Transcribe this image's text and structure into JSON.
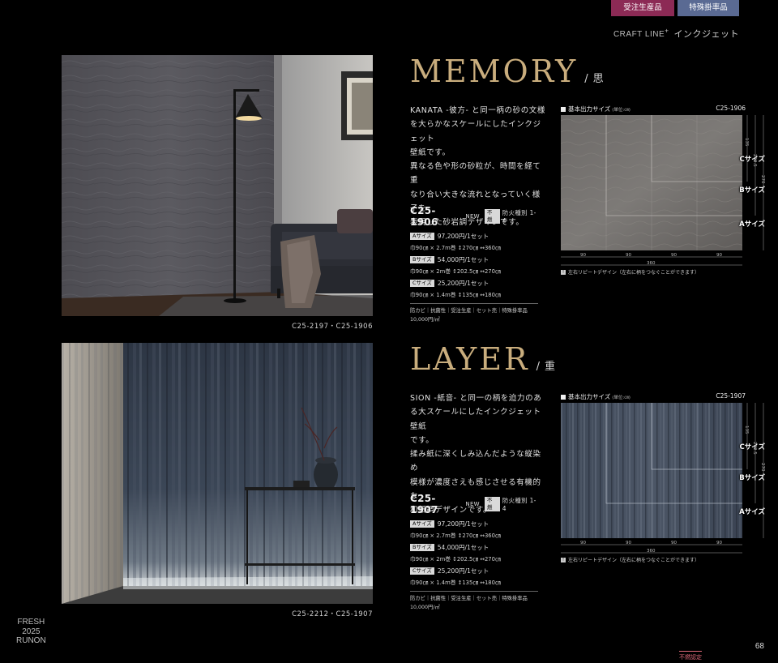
{
  "header": {
    "tag_made_to_order": "受注生産品",
    "tag_special_order": "特殊掛率品",
    "series_brand": "CRAFT LINE",
    "series_mark": "+",
    "series_type": "インクジェット"
  },
  "sections": [
    {
      "title_en": "MEMORY",
      "slash": "/",
      "title_jp": "思",
      "photo_credit": "C25-2197・C25-1906",
      "description": [
        "KANATA -彼方- と同一柄の砂の文様",
        "を大らかなスケールにしたインクジェット",
        "壁紙です。",
        "異なる色や形の砂粒が、時間を経て重",
        "なり合い大きな流れとなっていく様子を",
        "表現した砂岩調デザインです。"
      ],
      "product": {
        "code": "C25-1906",
        "new_label": "NEW",
        "fire_badge": "不燃",
        "fire_class": "防火種別 1-4",
        "sizes": [
          {
            "badge": "Aサイズ",
            "price": "97,200円/1セット",
            "dims": "巾90㎝ × 2.7m巻 ↕270㎝ ↔360㎝"
          },
          {
            "badge": "Bサイズ",
            "price": "54,000円/1セット",
            "dims": "巾90㎝ × 2m巻 ↕202.5㎝ ↔270㎝"
          },
          {
            "badge": "Cサイズ",
            "price": "25,200円/1セット",
            "dims": "巾90㎝ × 1.4m巻 ↕135㎝ ↔180㎝"
          }
        ],
        "features": "防カビ｜抗菌性｜受注生産｜セット売｜特殊掛率品",
        "unit_price": "10,000円/㎡"
      },
      "diagram": {
        "label": "基本出力サイズ",
        "unit": "(単位:㎝)",
        "code": "C25-1906",
        "size_c": "Cサイズ",
        "size_b": "Bサイズ",
        "size_a": "Aサイズ",
        "h135": "135",
        "h2025": "202.5",
        "h270": "270",
        "w90": "90",
        "w360": "360",
        "repeat_icon": "!",
        "repeat_note": "左右リピートデザイン（左右に柄をつなぐことができます）"
      }
    },
    {
      "title_en": "LAYER",
      "slash": "/",
      "title_jp": "重",
      "photo_credit": "C25-2212・C25-1907",
      "description": [
        "SION -紙音- と同一の柄を迫力のあ",
        "る大スケールにしたインクジェット壁紙",
        "です。",
        "揉み紙に深くしみ込んだような縦染め",
        "模様が濃度さえも感じさせる有機的な",
        "和紙調デザインです。"
      ],
      "product": {
        "code": "C25-1907",
        "new_label": "NEW",
        "fire_badge": "不燃",
        "fire_class": "防火種別 1-4",
        "sizes": [
          {
            "badge": "Aサイズ",
            "price": "97,200円/1セット",
            "dims": "巾90㎝ × 2.7m巻 ↕270㎝ ↔360㎝"
          },
          {
            "badge": "Bサイズ",
            "price": "54,000円/1セット",
            "dims": "巾90㎝ × 2m巻 ↕202.5㎝ ↔270㎝"
          },
          {
            "badge": "Cサイズ",
            "price": "25,200円/1セット",
            "dims": "巾90㎝ × 1.4m巻 ↕135㎝ ↔180㎝"
          }
        ],
        "features": "防カビ｜抗菌性｜受注生産｜セット売｜特殊掛率品",
        "unit_price": "10,000円/㎡"
      },
      "diagram": {
        "label": "基本出力サイズ",
        "unit": "(単位:㎝)",
        "code": "C25-1907",
        "size_c": "Cサイズ",
        "size_b": "Bサイズ",
        "size_a": "Aサイズ",
        "h135": "135",
        "h2025": "202.5",
        "h270": "270",
        "w90": "90",
        "w360": "360",
        "repeat_icon": "!",
        "repeat_note": "左右リピートデザイン（左右に柄をつなぐことができます）"
      }
    }
  ],
  "footer": {
    "brand_line1": "FRESH",
    "brand_line2": "2025",
    "brand_line3": "RUNON",
    "page_number": "68",
    "footer_badge": "不燃認定"
  },
  "colors": {
    "background": "#000000",
    "title_gold": "#c9ad7d",
    "tag_made": "#8c2a55",
    "tag_special": "#5a6a93",
    "footer_badge": "#e06a7a"
  }
}
